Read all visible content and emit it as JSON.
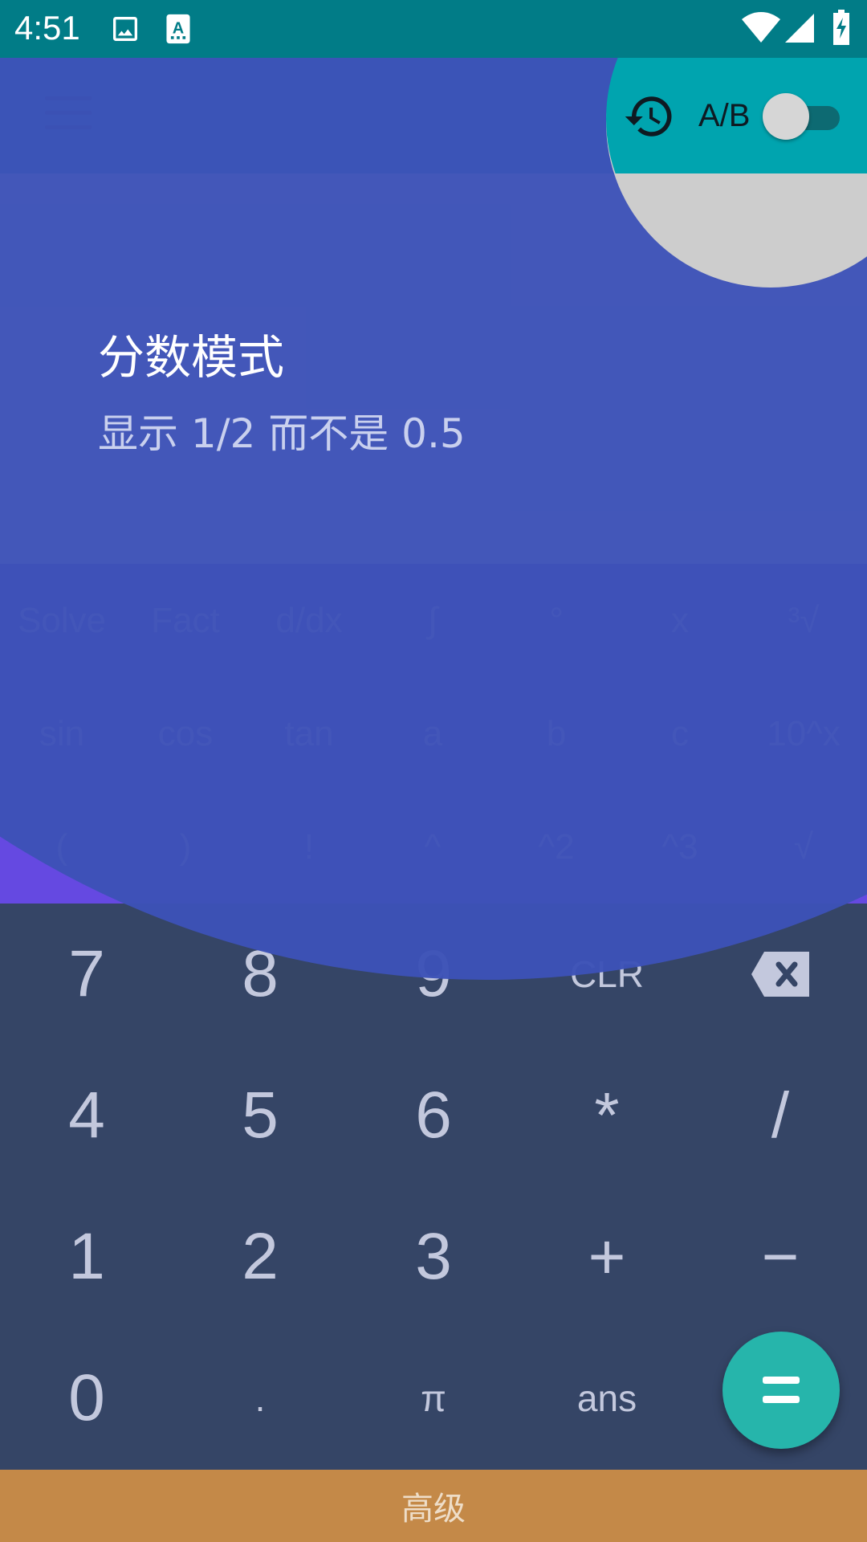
{
  "status_bar": {
    "time": "4:51",
    "icons": [
      "image-icon",
      "text-recognition-icon",
      "wifi-icon",
      "signal-icon",
      "battery-charging-icon"
    ]
  },
  "top_bar": {
    "menu_icon": "hamburger-menu-icon",
    "history_icon": "history-icon",
    "ab_label": "A/B",
    "ab_toggle_on": false
  },
  "tutorial": {
    "title": "分数模式",
    "description": "显示 1/2 而不是 0.5"
  },
  "scientific": {
    "rows": [
      [
        "Solve",
        "Fact",
        "d/dx",
        "∫",
        "°",
        "x",
        "³√"
      ],
      [
        "sin",
        "cos",
        "tan",
        "a",
        "b",
        "c",
        "10^x"
      ],
      [
        "(",
        ")",
        "!",
        "^",
        "^2",
        "^3",
        "√"
      ]
    ]
  },
  "keypad": {
    "rows": [
      [
        "7",
        "8",
        "9",
        "CLR",
        ""
      ],
      [
        "4",
        "5",
        "6",
        "*",
        "/"
      ],
      [
        "1",
        "2",
        "3",
        "+",
        "−"
      ],
      [
        "0",
        ".",
        "π",
        "ans",
        ""
      ]
    ],
    "backspace_icon": "backspace-icon",
    "equals_icon": "equals-icon"
  },
  "advanced_label": "高级",
  "colors": {
    "status_bar": "#017C87",
    "top_bar": "#00A4AF",
    "scientific_panel": "#6549E1",
    "keypad": "#354566",
    "equals_fab": "#26B5AB",
    "advanced_bar": "#C48948",
    "tour_overlay": "#3D52B7"
  }
}
